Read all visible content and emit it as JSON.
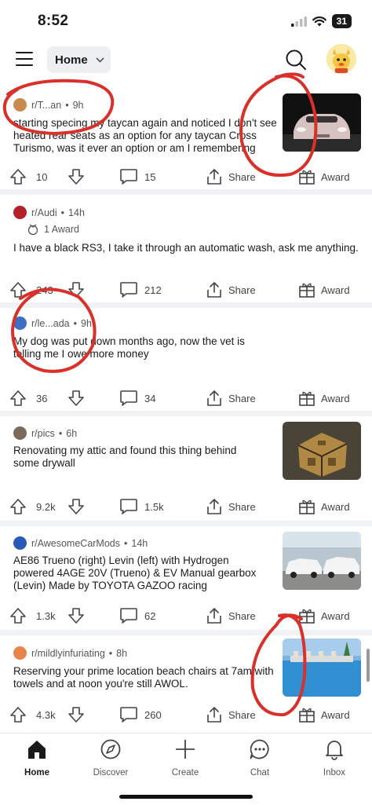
{
  "status": {
    "time": "8:52",
    "battery": "31"
  },
  "header": {
    "feed_label": "Home"
  },
  "posts": [
    {
      "subreddit": "r/T...an",
      "age": "9h",
      "title": "starting specing my taycan again and noticed I don't see heated rear seats as an option for any taycan Cross Turismo, was it ever an option or am I remembering incorrectly?",
      "upvotes": "10",
      "comments": "15",
      "share": "Share",
      "award": "Award"
    },
    {
      "subreddit": "r/Audi",
      "age": "14h",
      "awards": "1 Award",
      "title": "I have a black RS3, I take it through an automatic wash, ask me anything.",
      "upvotes": "243",
      "comments": "212",
      "share": "Share",
      "award": "Award"
    },
    {
      "subreddit": "r/le...ada",
      "age": "9h",
      "title": "My dog was put down months ago, now the vet is telling me I owe more money",
      "upvotes": "36",
      "comments": "34",
      "share": "Share",
      "award": "Award"
    },
    {
      "subreddit": "r/pics",
      "age": "6h",
      "title": "Renovating my attic and found this thing behind some drywall",
      "upvotes": "9.2k",
      "comments": "1.5k",
      "share": "Share",
      "award": "Award"
    },
    {
      "subreddit": "r/AwesomeCarMods",
      "age": "14h",
      "title": "AE86 Trueno (right) Levin (left) with Hydrogen powered 4AGE 20V (Trueno) & EV Manual gearbox (Levin) Made by TOYOTA GAZOO racing",
      "upvotes": "1.3k",
      "comments": "62",
      "share": "Share",
      "award": "Award"
    },
    {
      "subreddit": "r/mildlyinfuriating",
      "age": "8h",
      "title": "Reserving your prime location beach chairs at 7am with towels and at noon you're still AWOL.",
      "upvotes": "4.3k",
      "comments": "260",
      "share": "Share",
      "award": "Award"
    }
  ],
  "tabs": [
    {
      "label": "Home",
      "icon": "home-icon"
    },
    {
      "label": "Discover",
      "icon": "compass-icon"
    },
    {
      "label": "Create",
      "icon": "plus-icon"
    },
    {
      "label": "Chat",
      "icon": "chat-icon"
    },
    {
      "label": "Inbox",
      "icon": "bell-icon"
    }
  ],
  "colors": {
    "annotation": "#d9302a",
    "accent": "#1a1a1b",
    "divider": "#f1f2f4"
  }
}
